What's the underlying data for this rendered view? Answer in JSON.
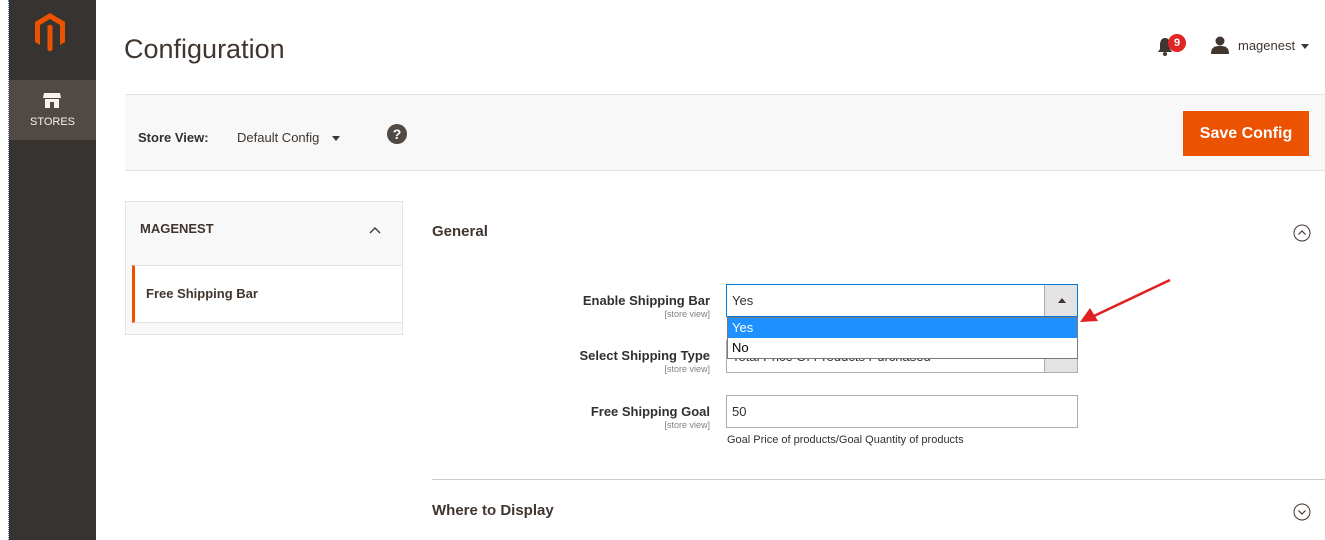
{
  "menu": {
    "stores_label": "STORES"
  },
  "header": {
    "title": "Configuration",
    "notification_count": "9",
    "username": "magenest"
  },
  "store_bar": {
    "label": "Store View:",
    "value": "Default Config",
    "save_label": "Save Config"
  },
  "sidebar": {
    "title": "MAGENEST",
    "items": [
      {
        "label": "Free Shipping Bar"
      }
    ]
  },
  "sections": [
    {
      "title": "General"
    },
    {
      "title": "Where to Display"
    }
  ],
  "fields": {
    "enable": {
      "label": "Enable Shipping Bar",
      "scope": "[store view]",
      "value": "Yes",
      "options": [
        "Yes",
        "No"
      ]
    },
    "type": {
      "label": "Select Shipping Type",
      "scope": "[store view]",
      "value": "Total Price Of Products Purchased"
    },
    "goal": {
      "label": "Free Shipping Goal",
      "scope": "[store view]",
      "value": "50",
      "note": "Goal Price of products/Goal Quantity of products"
    }
  },
  "colors": {
    "accent": "#eb5202",
    "menu_bg": "#373330",
    "selected_option": "#1e90ff",
    "annotation_arrow": "#e02020"
  }
}
